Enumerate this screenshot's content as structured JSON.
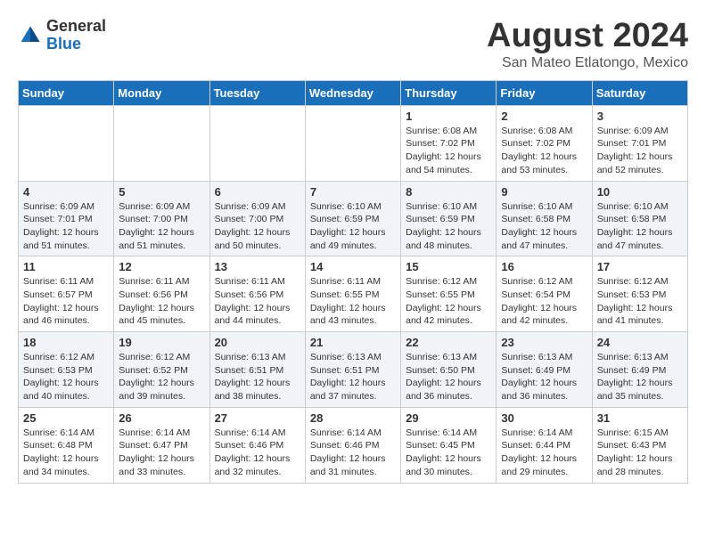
{
  "logo": {
    "text_general": "General",
    "text_blue": "Blue"
  },
  "title": {
    "month": "August 2024",
    "location": "San Mateo Etlatongo, Mexico"
  },
  "days_of_week": [
    "Sunday",
    "Monday",
    "Tuesday",
    "Wednesday",
    "Thursday",
    "Friday",
    "Saturday"
  ],
  "weeks": [
    [
      {
        "day": "",
        "info": ""
      },
      {
        "day": "",
        "info": ""
      },
      {
        "day": "",
        "info": ""
      },
      {
        "day": "",
        "info": ""
      },
      {
        "day": "1",
        "info": "Sunrise: 6:08 AM\nSunset: 7:02 PM\nDaylight: 12 hours and 54 minutes."
      },
      {
        "day": "2",
        "info": "Sunrise: 6:08 AM\nSunset: 7:02 PM\nDaylight: 12 hours and 53 minutes."
      },
      {
        "day": "3",
        "info": "Sunrise: 6:09 AM\nSunset: 7:01 PM\nDaylight: 12 hours and 52 minutes."
      }
    ],
    [
      {
        "day": "4",
        "info": "Sunrise: 6:09 AM\nSunset: 7:01 PM\nDaylight: 12 hours and 51 minutes."
      },
      {
        "day": "5",
        "info": "Sunrise: 6:09 AM\nSunset: 7:00 PM\nDaylight: 12 hours and 51 minutes."
      },
      {
        "day": "6",
        "info": "Sunrise: 6:09 AM\nSunset: 7:00 PM\nDaylight: 12 hours and 50 minutes."
      },
      {
        "day": "7",
        "info": "Sunrise: 6:10 AM\nSunset: 6:59 PM\nDaylight: 12 hours and 49 minutes."
      },
      {
        "day": "8",
        "info": "Sunrise: 6:10 AM\nSunset: 6:59 PM\nDaylight: 12 hours and 48 minutes."
      },
      {
        "day": "9",
        "info": "Sunrise: 6:10 AM\nSunset: 6:58 PM\nDaylight: 12 hours and 47 minutes."
      },
      {
        "day": "10",
        "info": "Sunrise: 6:10 AM\nSunset: 6:58 PM\nDaylight: 12 hours and 47 minutes."
      }
    ],
    [
      {
        "day": "11",
        "info": "Sunrise: 6:11 AM\nSunset: 6:57 PM\nDaylight: 12 hours and 46 minutes."
      },
      {
        "day": "12",
        "info": "Sunrise: 6:11 AM\nSunset: 6:56 PM\nDaylight: 12 hours and 45 minutes."
      },
      {
        "day": "13",
        "info": "Sunrise: 6:11 AM\nSunset: 6:56 PM\nDaylight: 12 hours and 44 minutes."
      },
      {
        "day": "14",
        "info": "Sunrise: 6:11 AM\nSunset: 6:55 PM\nDaylight: 12 hours and 43 minutes."
      },
      {
        "day": "15",
        "info": "Sunrise: 6:12 AM\nSunset: 6:55 PM\nDaylight: 12 hours and 42 minutes."
      },
      {
        "day": "16",
        "info": "Sunrise: 6:12 AM\nSunset: 6:54 PM\nDaylight: 12 hours and 42 minutes."
      },
      {
        "day": "17",
        "info": "Sunrise: 6:12 AM\nSunset: 6:53 PM\nDaylight: 12 hours and 41 minutes."
      }
    ],
    [
      {
        "day": "18",
        "info": "Sunrise: 6:12 AM\nSunset: 6:53 PM\nDaylight: 12 hours and 40 minutes."
      },
      {
        "day": "19",
        "info": "Sunrise: 6:12 AM\nSunset: 6:52 PM\nDaylight: 12 hours and 39 minutes."
      },
      {
        "day": "20",
        "info": "Sunrise: 6:13 AM\nSunset: 6:51 PM\nDaylight: 12 hours and 38 minutes."
      },
      {
        "day": "21",
        "info": "Sunrise: 6:13 AM\nSunset: 6:51 PM\nDaylight: 12 hours and 37 minutes."
      },
      {
        "day": "22",
        "info": "Sunrise: 6:13 AM\nSunset: 6:50 PM\nDaylight: 12 hours and 36 minutes."
      },
      {
        "day": "23",
        "info": "Sunrise: 6:13 AM\nSunset: 6:49 PM\nDaylight: 12 hours and 36 minutes."
      },
      {
        "day": "24",
        "info": "Sunrise: 6:13 AM\nSunset: 6:49 PM\nDaylight: 12 hours and 35 minutes."
      }
    ],
    [
      {
        "day": "25",
        "info": "Sunrise: 6:14 AM\nSunset: 6:48 PM\nDaylight: 12 hours and 34 minutes."
      },
      {
        "day": "26",
        "info": "Sunrise: 6:14 AM\nSunset: 6:47 PM\nDaylight: 12 hours and 33 minutes."
      },
      {
        "day": "27",
        "info": "Sunrise: 6:14 AM\nSunset: 6:46 PM\nDaylight: 12 hours and 32 minutes."
      },
      {
        "day": "28",
        "info": "Sunrise: 6:14 AM\nSunset: 6:46 PM\nDaylight: 12 hours and 31 minutes."
      },
      {
        "day": "29",
        "info": "Sunrise: 6:14 AM\nSunset: 6:45 PM\nDaylight: 12 hours and 30 minutes."
      },
      {
        "day": "30",
        "info": "Sunrise: 6:14 AM\nSunset: 6:44 PM\nDaylight: 12 hours and 29 minutes."
      },
      {
        "day": "31",
        "info": "Sunrise: 6:15 AM\nSunset: 6:43 PM\nDaylight: 12 hours and 28 minutes."
      }
    ]
  ]
}
